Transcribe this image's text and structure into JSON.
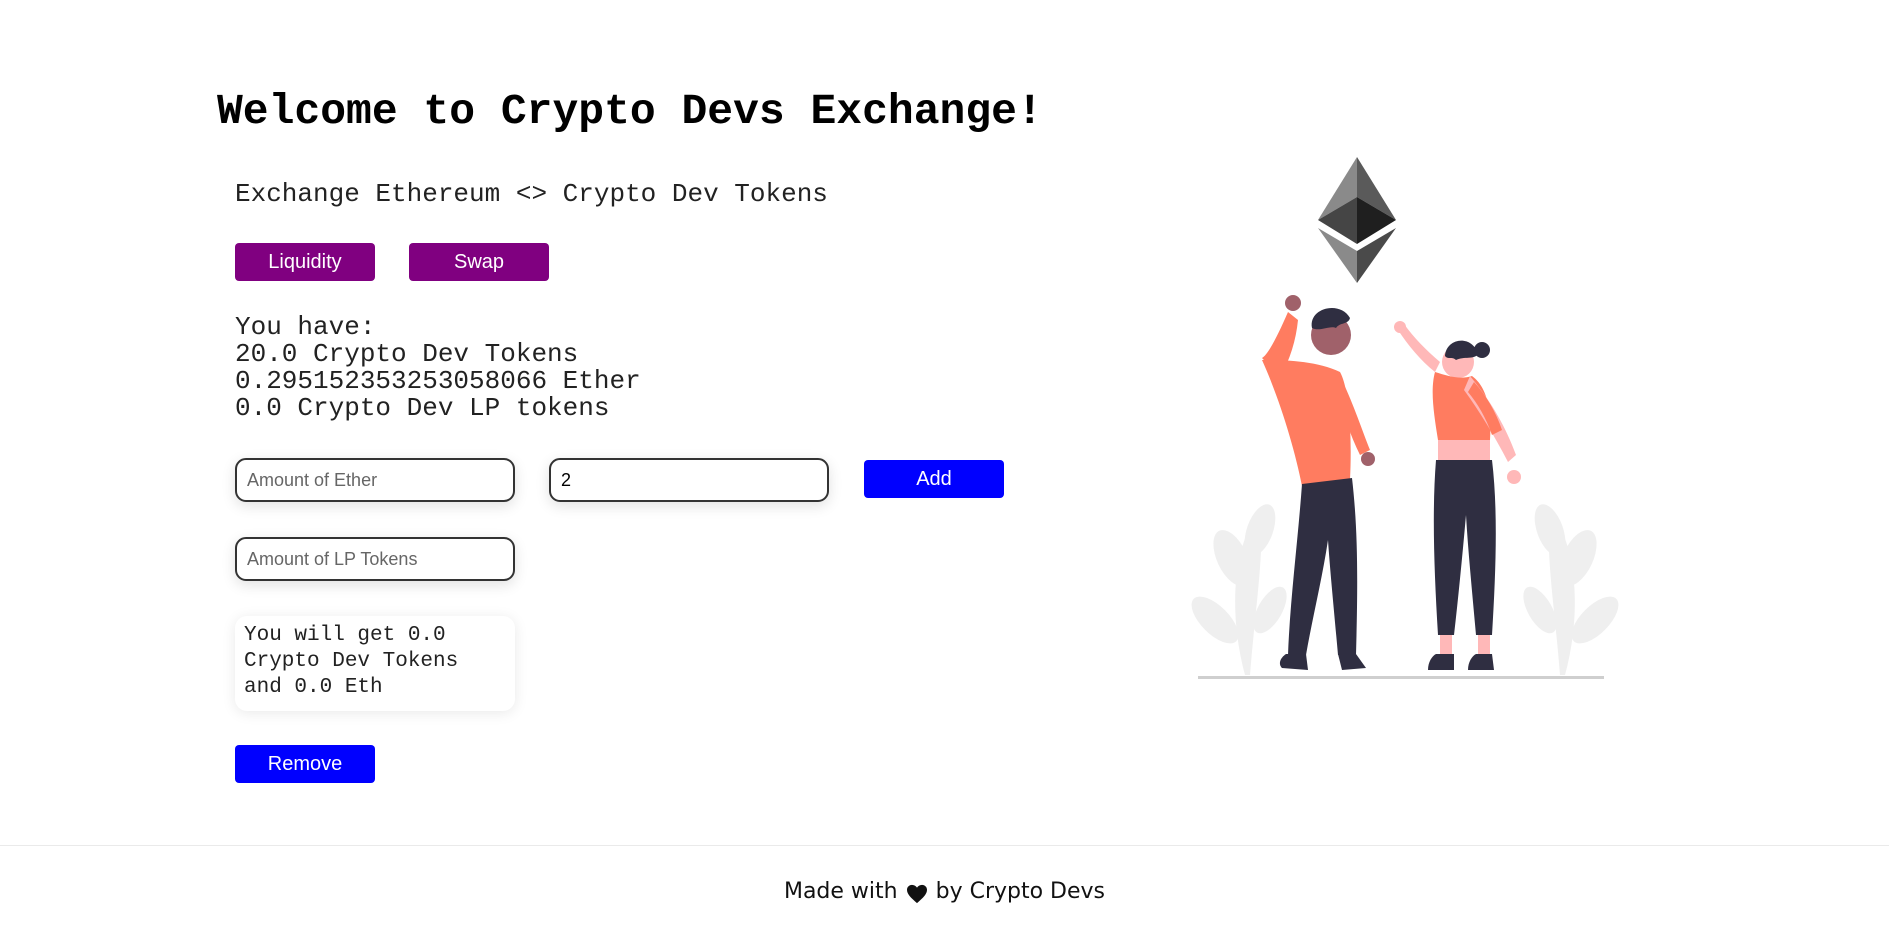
{
  "header": {
    "title": "Welcome to Crypto Devs Exchange!",
    "subtitle": "Exchange Ethereum <> Crypto Dev Tokens"
  },
  "tabs": {
    "liquidity_label": "Liquidity",
    "swap_label": "Swap"
  },
  "balances": {
    "heading": "You have:",
    "tokens": "20.0 Crypto Dev Tokens",
    "ether": "0.295152353253058066 Ether",
    "lp_tokens": "0.0 Crypto Dev LP tokens"
  },
  "add_liquidity": {
    "ether_placeholder": "Amount of Ether",
    "ether_value": "",
    "token_value": "2",
    "add_label": "Add"
  },
  "remove_liquidity": {
    "lp_placeholder": "Amount of LP Tokens",
    "lp_value": "",
    "result_text": "You will get 0.0 Crypto Dev Tokens and 0.0 Eth",
    "remove_label": "Remove"
  },
  "footer": {
    "prefix": "Made with",
    "suffix": "by Crypto Devs",
    "icon": "heart-icon"
  },
  "colors": {
    "tab_button": "#800080",
    "action_button": "#0000ff",
    "figure_shirt": "#ff7c60",
    "figure_pants": "#2f2e41"
  }
}
